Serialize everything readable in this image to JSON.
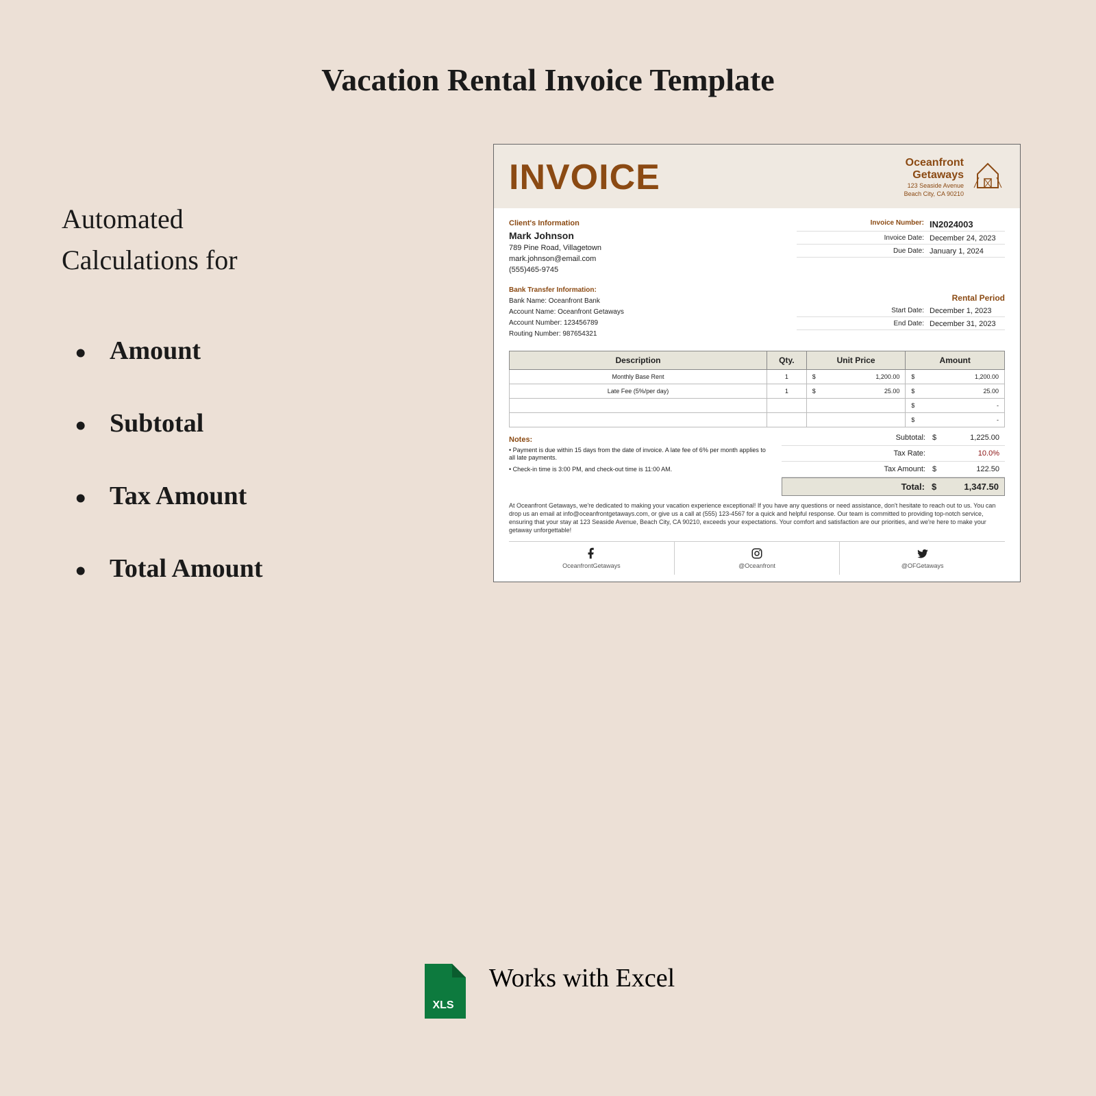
{
  "title": "Vacation Rental Invoice Template",
  "subtitle_line1": "Automated",
  "subtitle_line2": "Calculations for",
  "bullets": [
    "Amount",
    " Subtotal",
    " Tax Amount",
    "Total Amount"
  ],
  "footer": {
    "xls_label": "XLS",
    "text": "Works with Excel"
  },
  "invoice": {
    "heading": "INVOICE",
    "company": {
      "name_line1": "Oceanfront",
      "name_line2": "Getaways",
      "addr_line1": "123 Seaside Avenue",
      "addr_line2": "Beach City, CA 90210"
    },
    "client_section": "Client's Information",
    "client": {
      "name": "Mark Johnson",
      "address": "789 Pine Road, Villagetown",
      "email": "mark.johnson@email.com",
      "phone": "(555)465-9745"
    },
    "meta": {
      "invoice_number_label": "Invoice Number:",
      "invoice_number": "IN2024003",
      "invoice_date_label": "Invoice Date:",
      "invoice_date": "December 24, 2023",
      "due_date_label": "Due Date:",
      "due_date": "January 1, 2024"
    },
    "bank_section": "Bank Transfer Information:",
    "bank": {
      "bank_name": "Bank Name: Oceanfront Bank",
      "account_name": "Account Name: Oceanfront Getaways",
      "account_number": "Account Number: 123456789",
      "routing_number": "Routing Number: 987654321"
    },
    "rental_section": "Rental Period",
    "rental": {
      "start_label": "Start Date:",
      "start": "December 1, 2023",
      "end_label": "End Date:",
      "end": "December 31, 2023"
    },
    "columns": {
      "desc": "Description",
      "qty": "Qty.",
      "price": "Unit Price",
      "amount": "Amount"
    },
    "items": [
      {
        "desc": "Monthly Base Rent",
        "qty": "1",
        "price": "1,200.00",
        "amount": "1,200.00"
      },
      {
        "desc": "Late Fee (5%/per day)",
        "qty": "1",
        "price": "25.00",
        "amount": "25.00"
      }
    ],
    "empty_rows": [
      "-",
      "-"
    ],
    "currency": "$",
    "totals": {
      "subtotal_label": "Subtotal:",
      "subtotal": "1,225.00",
      "taxrate_label": "Tax Rate:",
      "taxrate": "10.0%",
      "taxamount_label": "Tax Amount:",
      "taxamount": "122.50",
      "total_label": "Total:",
      "total": "1,347.50"
    },
    "notes_section": "Notes:",
    "notes": [
      "• Payment is due within 15 days from the date of invoice. A late fee of 6% per month applies to all late payments.",
      "• Check-in time is 3:00 PM, and check-out time is 11:00 AM."
    ],
    "blurb": "At Oceanfront Getaways, we're dedicated to making your vacation experience exceptional! If you have any questions or need assistance, don't hesitate to reach out to us. You can drop us an email at info@oceanfrontgetaways.com, or give us a call at (555) 123-4567 for a quick and helpful response. Our team is committed to providing top-notch service, ensuring that your stay at 123 Seaside Avenue, Beach City, CA 90210, exceeds your expectations. Your comfort and satisfaction are our priorities, and we're here to make your getaway unforgettable!",
    "social": {
      "facebook": "OceanfrontGetaways",
      "instagram": "@Oceanfront",
      "twitter": "@OFGetaways"
    }
  }
}
